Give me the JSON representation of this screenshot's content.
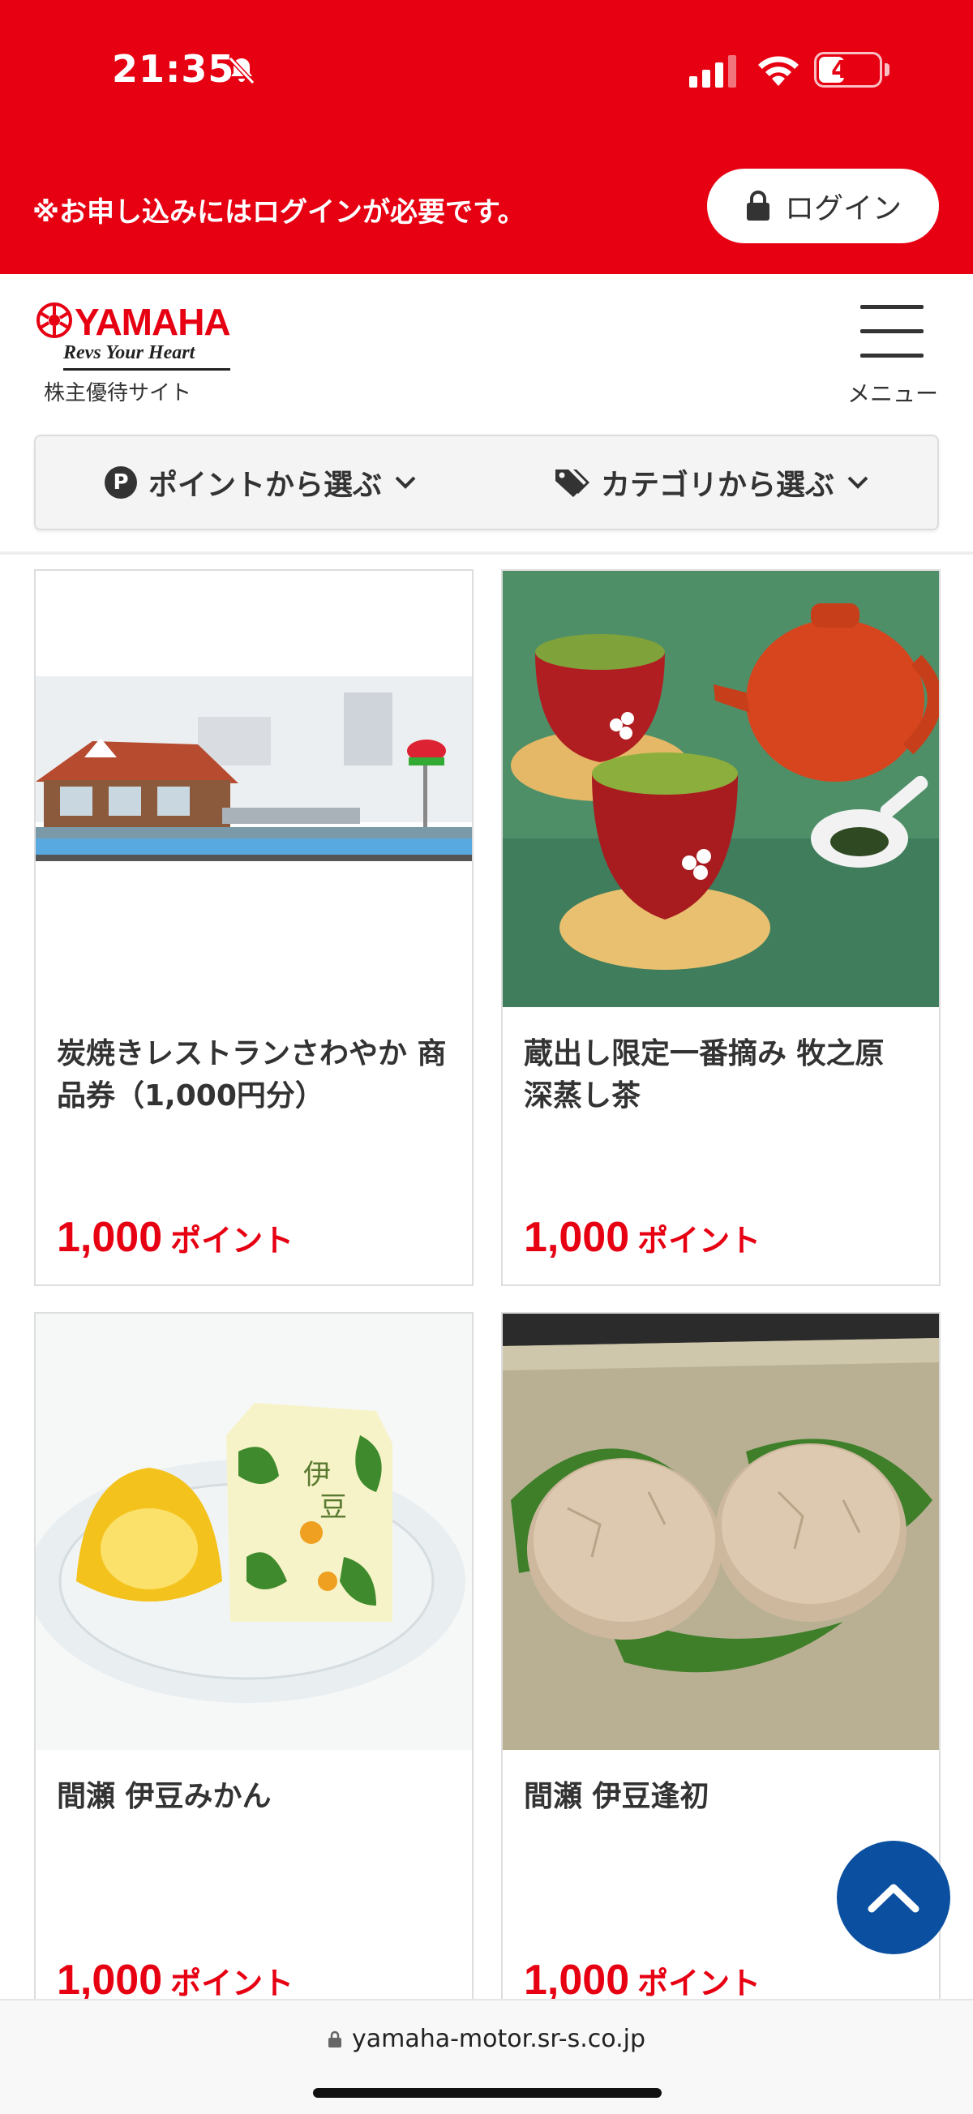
{
  "status_bar": {
    "time": "21:35",
    "battery": "40"
  },
  "banner": {
    "login_note": "※お申し込みにはログインが必要です。",
    "login_label": "ログイン"
  },
  "header": {
    "logo_text": "YAMAHA",
    "tagline": "Revs Your Heart",
    "subtitle": "株主優待サイト",
    "menu_label": "メニュー"
  },
  "filters": {
    "by_points": "ポイントから選ぶ",
    "by_category": "カテゴリから選ぶ",
    "points_icon_letter": "P"
  },
  "products": [
    {
      "name": "炭焼きレストランさわやか 商品券（1,000円分）",
      "points": "1,000",
      "unit": "ポイント"
    },
    {
      "name": "蔵出し限定一番摘み 牧之原 深蒸し茶",
      "points": "1,000",
      "unit": "ポイント"
    },
    {
      "name": "間瀬 伊豆みかん",
      "points": "1,000",
      "unit": "ポイント"
    },
    {
      "name": "間瀬 伊豆逢初",
      "points": "1,000",
      "unit": "ポイント"
    }
  ],
  "browser": {
    "url": "yamaha-motor.sr-s.co.jp"
  },
  "colors": {
    "brand_red": "#e60012",
    "scroll_top_blue": "#0a4fa0"
  }
}
